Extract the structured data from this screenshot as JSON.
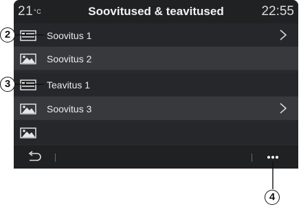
{
  "header": {
    "temperature": "21",
    "temperature_unit": "°C",
    "title": "Soovitused & teavitused",
    "time": "22:55"
  },
  "rows": [
    {
      "label": "Soovitus 1",
      "icon": "message-card-icon",
      "has_chevron": true
    },
    {
      "label": "Soovitus 2",
      "icon": "image-icon",
      "has_chevron": false
    },
    {
      "label": "Teavitus 1",
      "icon": "message-card-icon",
      "has_chevron": false
    },
    {
      "label": "Soovitus 3",
      "icon": "image-icon",
      "has_chevron": true
    },
    {
      "label": "",
      "icon": "image-icon",
      "has_chevron": false
    }
  ],
  "bottom_bar": {
    "back_icon": "back-arrow-icon",
    "more_icon": "more-options-icon"
  },
  "callouts": [
    "2",
    "3",
    "4"
  ],
  "colors": {
    "screen_bg": "#2a2b2d",
    "header_bg": "#202123",
    "text": "#ececec"
  }
}
